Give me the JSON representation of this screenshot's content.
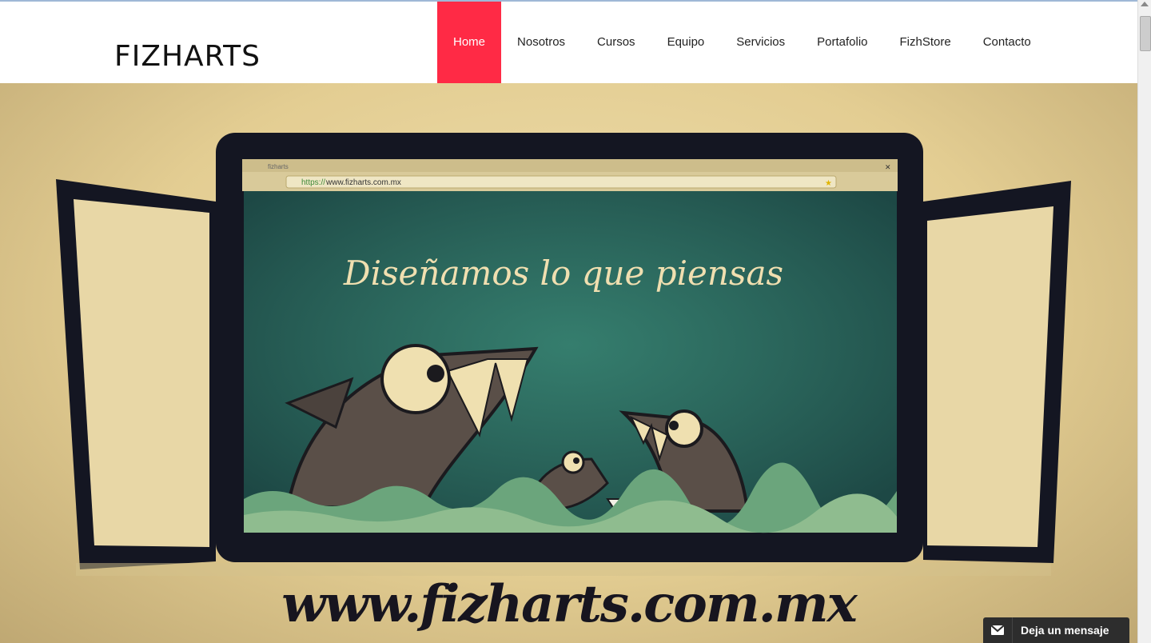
{
  "site": {
    "logo": "FIZHARTS"
  },
  "nav": {
    "items": [
      {
        "label": "Home",
        "active": true
      },
      {
        "label": "Nosotros"
      },
      {
        "label": "Cursos"
      },
      {
        "label": "Equipo"
      },
      {
        "label": "Servicios"
      },
      {
        "label": "Portafolio"
      },
      {
        "label": "FizhStore"
      },
      {
        "label": "Contacto"
      }
    ]
  },
  "hero": {
    "browser_tab": "fizharts",
    "url_scheme": "https://",
    "url_rest": "www.fizharts.com.mx",
    "slogan": "Diseñamos lo que piensas",
    "bottom_text": "www.fizharts.com.mx"
  },
  "chat": {
    "label": "Deja un mensaje",
    "icon": "envelope-icon"
  },
  "colors": {
    "accent": "#ff2a45",
    "screen": "#2b6b5e",
    "frame": "#141622"
  }
}
